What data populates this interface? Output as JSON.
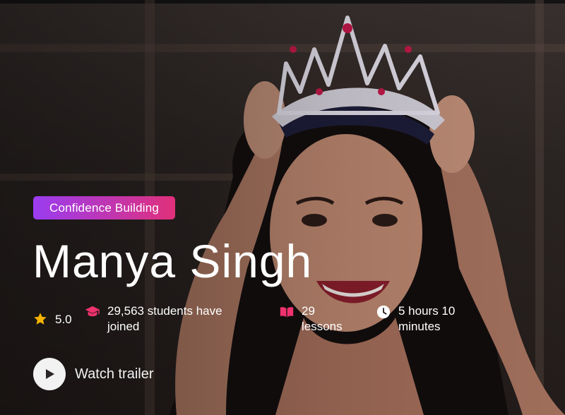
{
  "hero": {
    "category": "Confidence Building",
    "instructor_name": "Manya Singh",
    "stats": {
      "rating": "5.0",
      "students": "29,563 students have joined",
      "lessons": "29 lessons",
      "duration": "5 hours 10 minutes"
    },
    "watch_trailer_label": "Watch trailer"
  },
  "icons": {
    "rating": "star-icon",
    "students": "graduation-cap-icon",
    "lessons": "open-book-icon",
    "duration": "clock-icon",
    "trailer": "play-icon"
  },
  "colors": {
    "star": "#f5b400",
    "accent_pink": "#f0326e",
    "badge_gradient_start": "#9a3cf0",
    "badge_gradient_end": "#e0307a"
  }
}
